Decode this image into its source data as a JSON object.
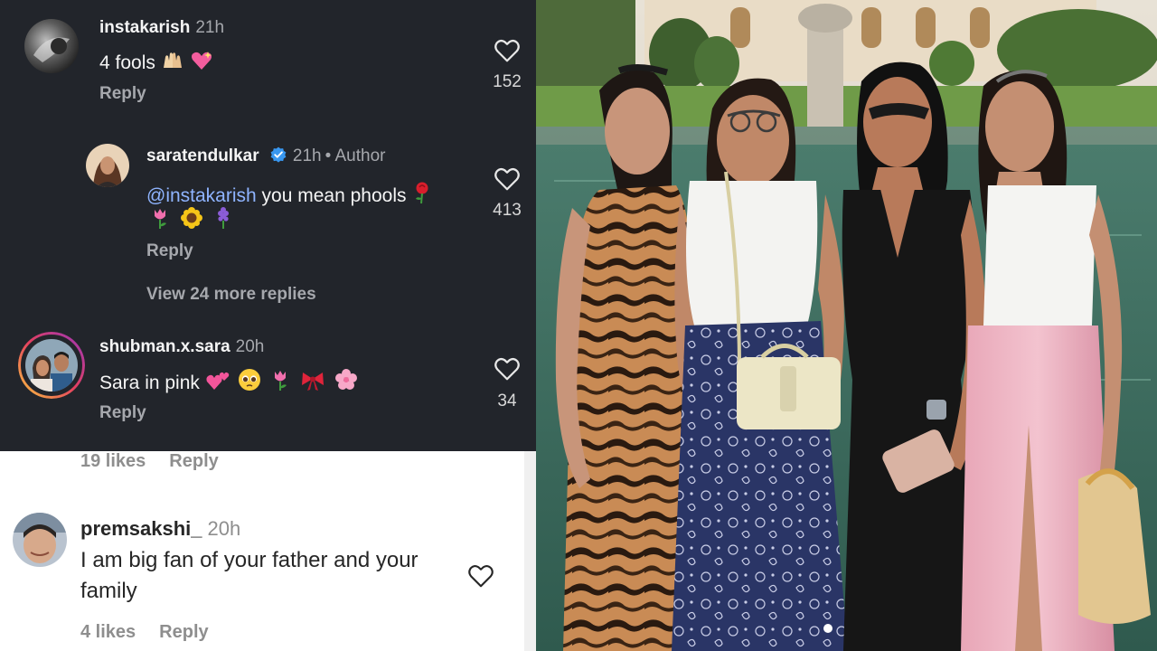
{
  "comments_dark": [
    {
      "username": "instakarish",
      "time": "21h",
      "text": "4 fools",
      "reply_label": "Reply",
      "likes": "152"
    },
    {
      "username": "saratendulkar",
      "time": "21h",
      "author_tag": "• Author",
      "mention": "@instakarish",
      "text": " you mean phools",
      "reply_label": "Reply",
      "likes": "413",
      "view_more": "View 24 more replies"
    },
    {
      "username": "shubman.x.sara",
      "time": "20h",
      "text": "Sara in pink",
      "reply_label": "Reply",
      "likes": "34"
    }
  ],
  "comments_light": {
    "previous_likes": "19 likes",
    "previous_reply": "Reply",
    "username": "premsakshi_",
    "time": "20h",
    "text": "I am big fan of your father and your family",
    "likes": "4 likes",
    "reply_label": "Reply"
  },
  "colors": {
    "dark_bg": "#22252b",
    "mention": "#8fb4ff",
    "verified": "#3897f0"
  },
  "icons": [
    "heart-icon",
    "verified-badge-icon",
    "carousel-dot-icon"
  ]
}
